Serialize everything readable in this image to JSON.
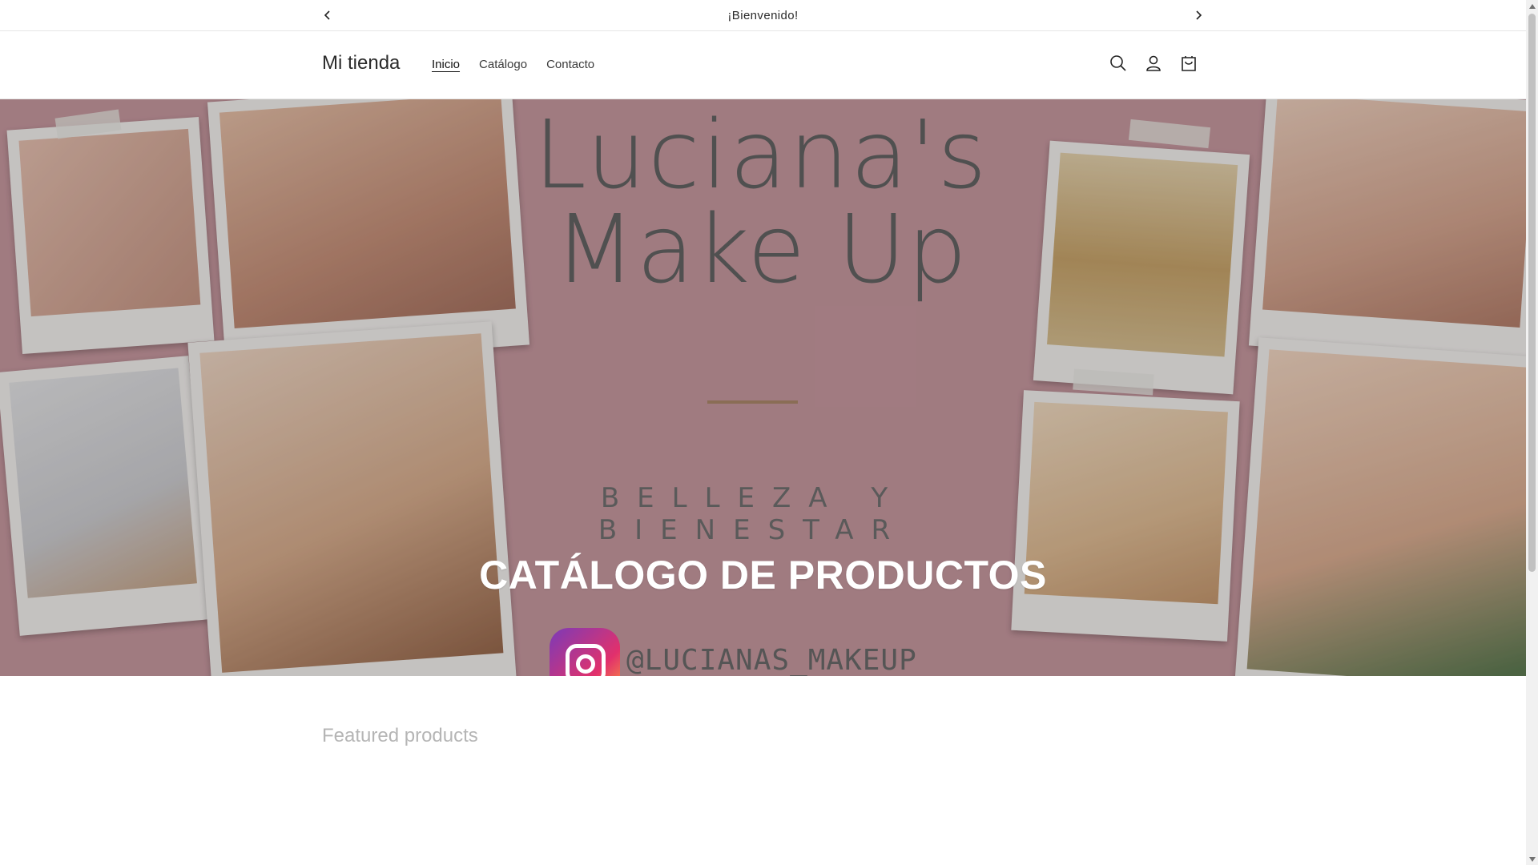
{
  "announcement": {
    "text": "¡Bienvenido!",
    "prev_icon": "chevron-left-icon",
    "next_icon": "chevron-right-icon"
  },
  "header": {
    "logo": "Mi tienda",
    "nav": [
      {
        "label": "Inicio",
        "active": true
      },
      {
        "label": "Catálogo",
        "active": false
      },
      {
        "label": "Contacto",
        "active": false
      }
    ],
    "icons": [
      "search-icon",
      "account-icon",
      "cart-icon"
    ]
  },
  "hero": {
    "brand_line1": "Luciana's",
    "brand_line2": "Make Up",
    "tagline": "BELLEZA Y BIENESTAR",
    "title": "CATÁLOGO DE PRODUCTOS",
    "instagram_handle": "@LUCIANAS_MAKEUP",
    "background_color": "#c99aa1"
  },
  "featured": {
    "heading": "Featured products"
  }
}
